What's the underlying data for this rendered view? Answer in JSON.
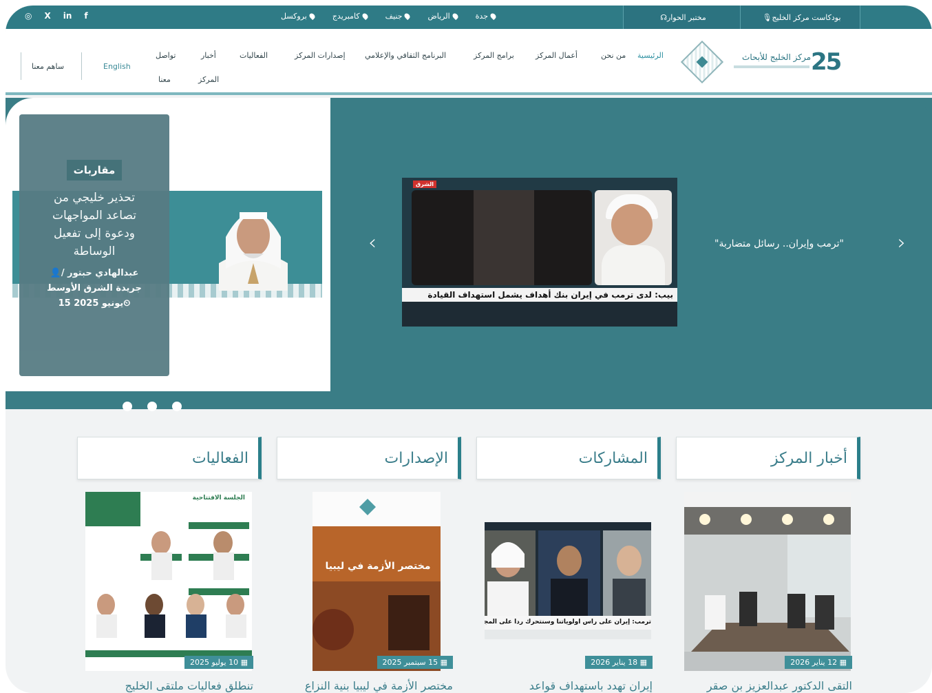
{
  "topbar": {
    "social": [
      "◎",
      "X",
      "in",
      "f"
    ],
    "cities": [
      "جدة",
      "الرياض",
      "جنيف",
      "كامبريدج",
      "بروكسل"
    ],
    "lab_label": "مختبر الحوار",
    "podcast_label": "بودكاست مركز الخليج"
  },
  "header": {
    "logo_number": "25",
    "logo_text": "مركز الخليج للأبحاث",
    "nav": {
      "home": "الرئيسية",
      "about": "من نحن",
      "works": "أعمال المركز",
      "programs": "برامج المركز",
      "cultural": "البرنامج الثقافي والإعلامي",
      "publications": "إصدارات المركز",
      "events": "الفعاليات",
      "news_line1": "أخبار",
      "news_line2": "المركز",
      "contact_line1": "تواصل",
      "contact_line2": "معنا"
    },
    "lang_label": "English",
    "contribute_label": "ساهم معنا"
  },
  "hero": {
    "badge": "مقاربات",
    "title": "تحذير خليجي من تصاعد المواجهات ودعوة إلى تفعيل الوساطة",
    "author": "عبدالهادي حبتور / جريدة الشرق الأوسط",
    "date": "15 يونيو 2025",
    "video_logo": "الشرق",
    "video_caption": "بيب: لدى ترمب في إيران بنك أهداف يشمل استهداف القيادة",
    "slide_title": "\"ترمب وإيران.. رسائل متضاربة\""
  },
  "columns": [
    {
      "title": "أخبار المركز",
      "date": "12 يناير 2026",
      "caption": "التقى الدكتور عبدالعزيز بن صقر"
    },
    {
      "title": "المشاركات",
      "date": "18 يناير 2026",
      "caption": "إيران تهدد باستهداف قواعد"
    },
    {
      "title": "الإصدارات",
      "date": "15 سبتمبر 2025",
      "caption": "مختصر الأزمة في ليبيا بنية النزاع"
    },
    {
      "title": "الفعاليات",
      "date": "10 يوليو 2025",
      "caption": "تنطلق فعاليات ملتقى الخليج"
    }
  ],
  "thumbs": {
    "publication_title": "مختصر الأزمة في ليبيا",
    "participation_caption": "ترمب: إيران على راس أولوياتنا وسنتحرك ردا على المجا",
    "event_header": "الجلسة الافتتاحية"
  }
}
